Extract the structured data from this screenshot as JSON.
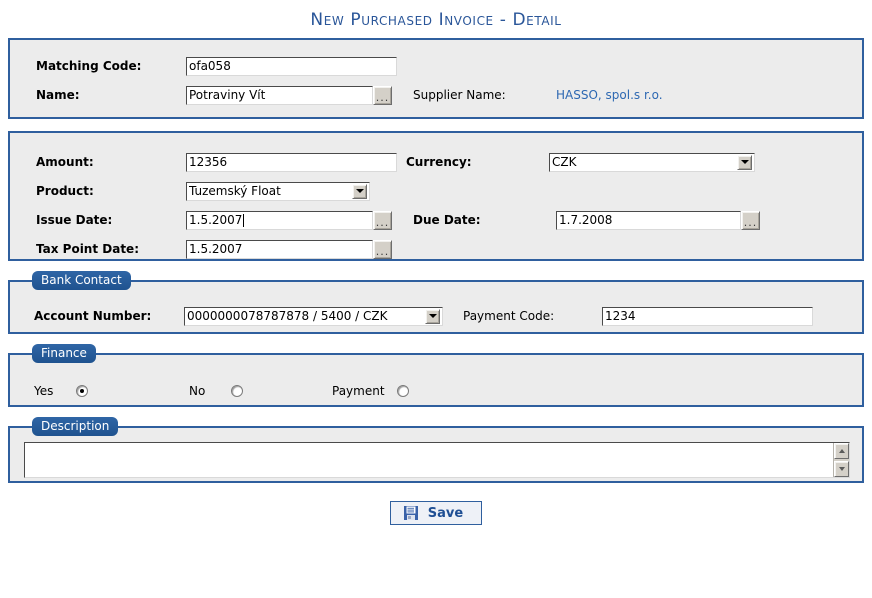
{
  "page": {
    "title": "New Purchased Invoice - Detail"
  },
  "identification": {
    "matching_code": {
      "label": "Matching Code:",
      "value": "ofa058"
    },
    "name": {
      "label": "Name:",
      "value": "Potraviny Vít",
      "browse_label": "..."
    },
    "supplier_name": {
      "label": "Supplier Name:",
      "value": "HASSO, spol.s r.o."
    }
  },
  "invoice": {
    "amount": {
      "label": "Amount:",
      "value": "12356"
    },
    "currency": {
      "label": "Currency:",
      "value": "CZK"
    },
    "product": {
      "label": "Product:",
      "value": "Tuzemský Float"
    },
    "issue_date": {
      "label": "Issue Date:",
      "value": "1.5.2007",
      "browse_label": "..."
    },
    "due_date": {
      "label": "Due Date:",
      "value": "1.7.2008",
      "browse_label": "..."
    },
    "tax_point_date": {
      "label": "Tax Point Date:",
      "value": "1.5.2007",
      "browse_label": "..."
    }
  },
  "bank_contact": {
    "legend": "Bank Contact",
    "account_number": {
      "label": "Account Number:",
      "value": "0000000078787878 / 5400 / CZK"
    },
    "payment_code": {
      "label": "Payment Code:",
      "value": "1234"
    }
  },
  "finance": {
    "legend": "Finance",
    "options": [
      {
        "label": "Yes",
        "checked": true
      },
      {
        "label": "No",
        "checked": false
      },
      {
        "label": "Payment",
        "checked": false
      }
    ]
  },
  "description": {
    "legend": "Description",
    "value": ""
  },
  "actions": {
    "save_label": "Save"
  },
  "colors": {
    "accent_blue": "#2f5f9e",
    "title_blue": "#2a5699",
    "link_blue": "#2d68b2",
    "panel_bg": "#ececec"
  }
}
